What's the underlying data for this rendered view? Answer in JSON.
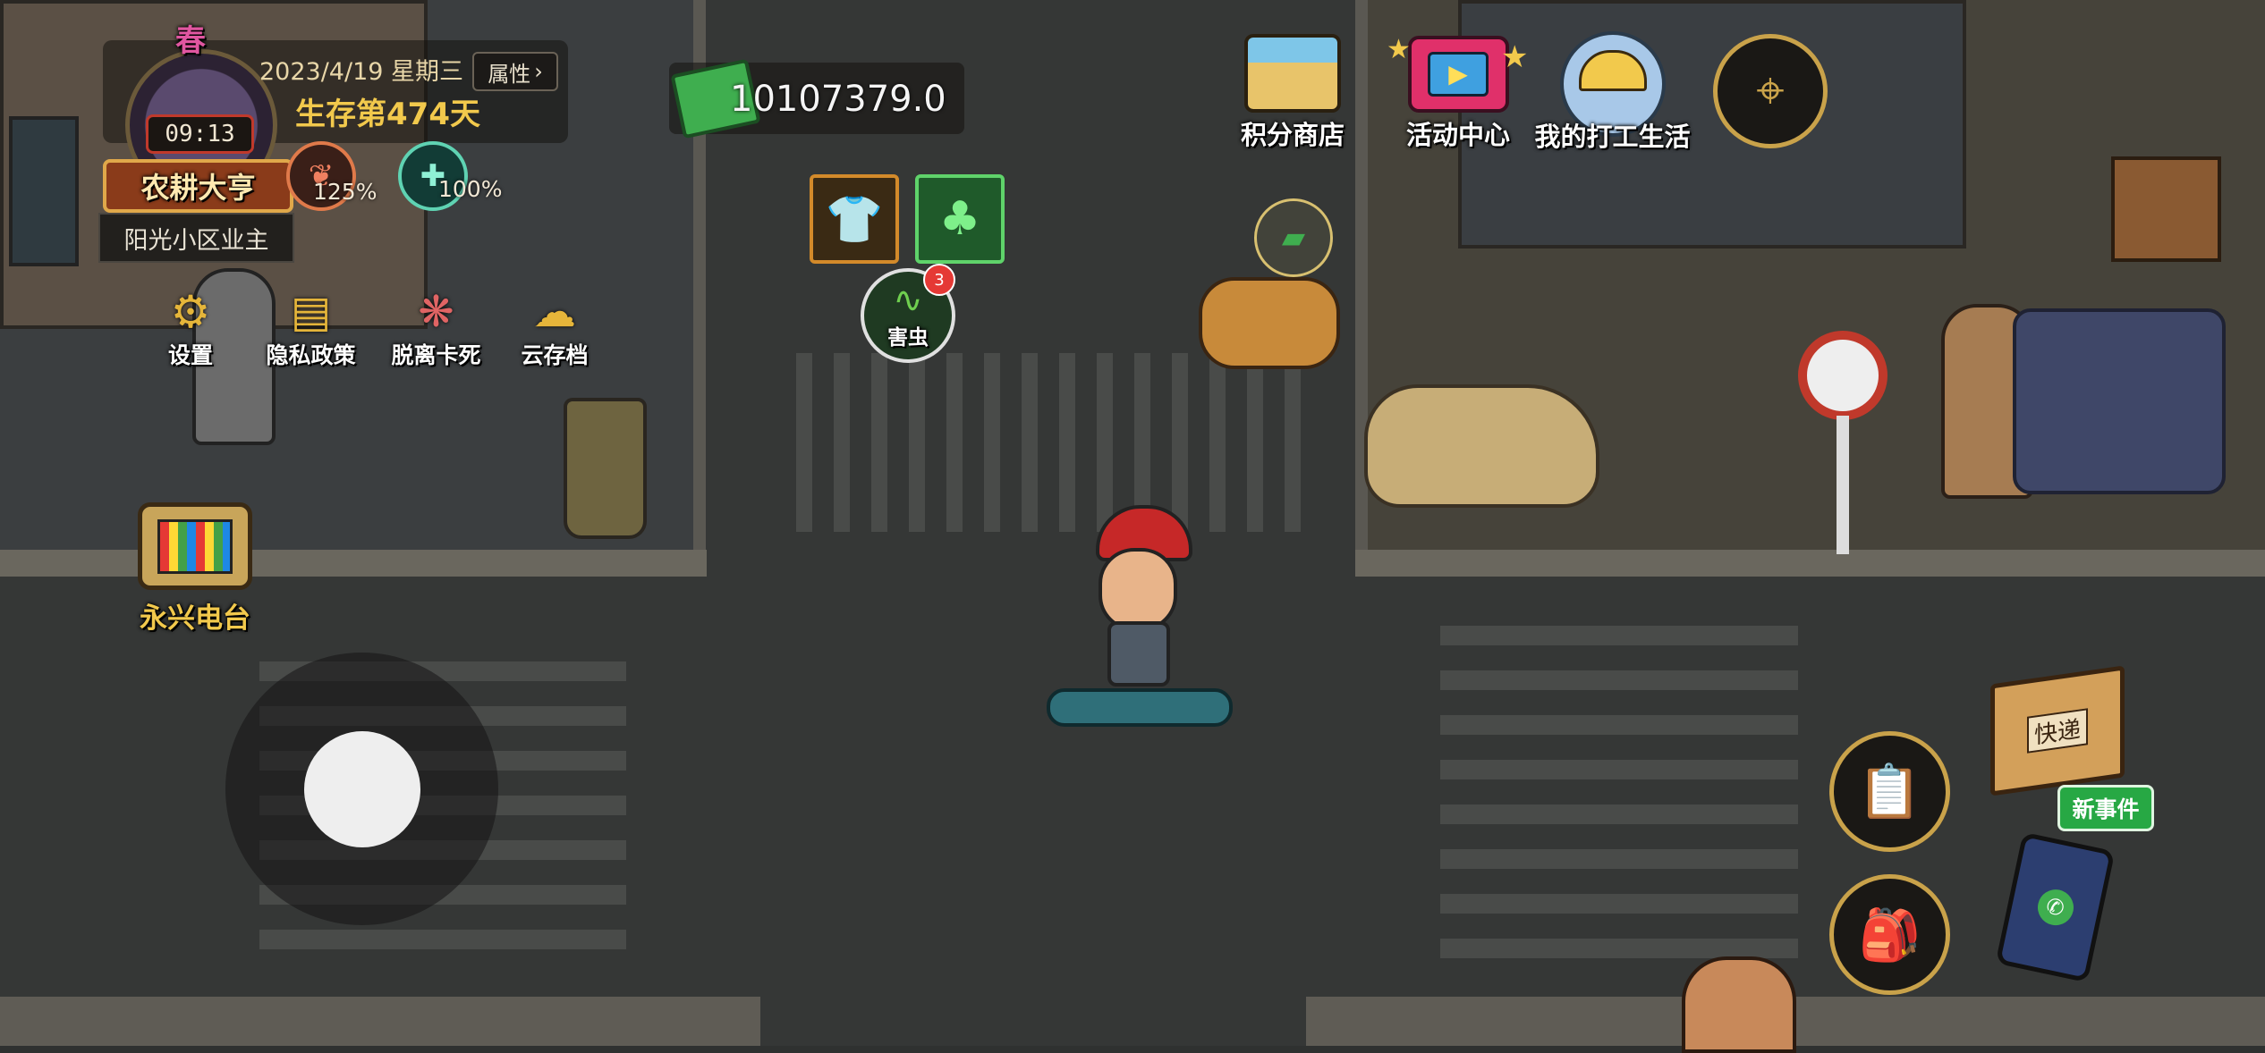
{
  "season": "春",
  "date": "2023/4/19 星期三",
  "attributes_button": "属性",
  "survival_day": "生存第474天",
  "clock_time": "09:13",
  "title_banner": "农耕大亨",
  "resident_label": "阳光小区业主",
  "stats": {
    "food_pct": "125%",
    "health_pct": "100%"
  },
  "menu": {
    "settings": "设置",
    "privacy": "隐私政策",
    "escape_death": "脱离卡死",
    "cloud_save": "云存档"
  },
  "money": "10107379.0",
  "top_buttons": {
    "points_shop": "积分商店",
    "event_center": "活动中心",
    "my_work_life": "我的打工生活"
  },
  "pest": {
    "label": "害虫",
    "count": "3"
  },
  "radio_station": "永兴电台",
  "delivery_box_text": "快递",
  "new_event": "新事件",
  "colors": {
    "accent_gold": "#f2c94c",
    "money_green": "#3fae4f",
    "new_event_green": "#27a844",
    "badge_red": "#e53935"
  }
}
